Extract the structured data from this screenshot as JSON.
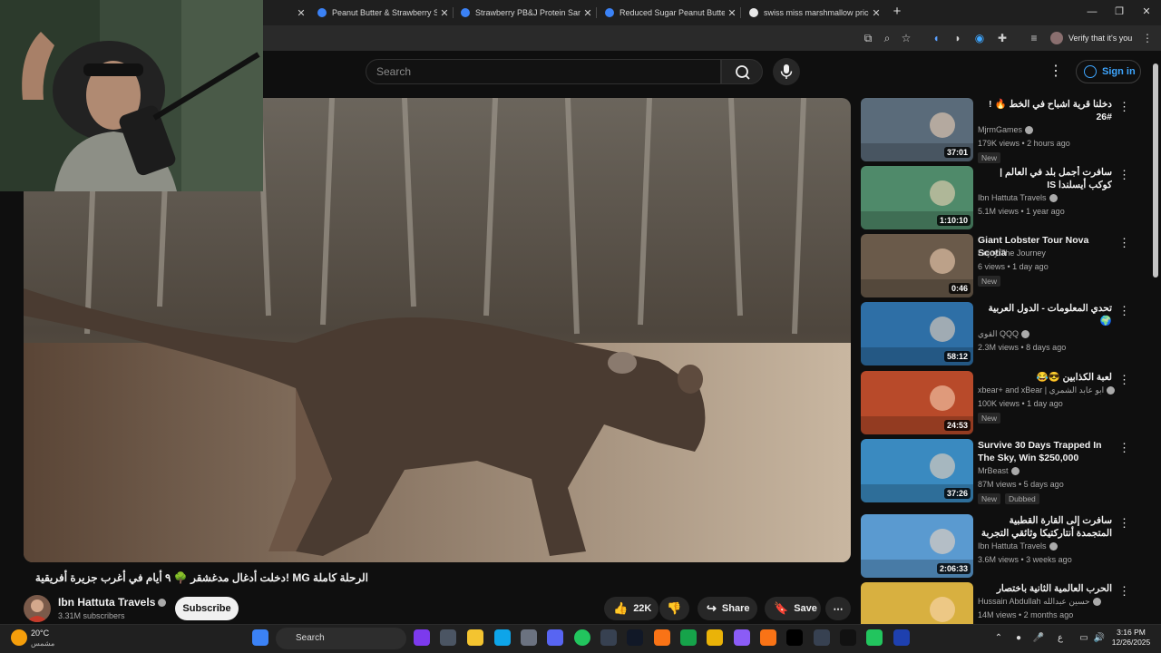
{
  "browser": {
    "tabs": [
      {
        "title": "Peanut Butter & Strawberry Sp"
      },
      {
        "title": "Strawberry PB&J Protein Sandw"
      },
      {
        "title": "Reduced Sugar Peanut Butter &"
      },
      {
        "title": "swiss miss marshmallow price -"
      }
    ],
    "profile_label": "Verify that it's you"
  },
  "header": {
    "search_placeholder": "Search",
    "sign_in": "Sign in"
  },
  "video": {
    "title": "الرحلة كاملة MG !دخلت أدغال مدغشقر 🌳 ٩ أيام في أغرب جزيرة أفريقية",
    "channel": "Ibn Hattuta Travels",
    "subscribers": "3.31M subscribers",
    "subscribe": "Subscribe",
    "likes": "22K",
    "share": "Share",
    "save": "Save"
  },
  "recommendations": [
    {
      "title": "دخلنا قرية اشباح في الخط 🔥 ! #26",
      "rtl": true,
      "channel": "MjrmGames",
      "verified": true,
      "meta": "179K views • 2 hours ago",
      "duration": "37:01",
      "badge": "New"
    },
    {
      "title": "سافرت أجمل بلد في العالم | كوكب أيسلندا IS",
      "rtl": true,
      "channel": "Ibn Hattuta Travels",
      "verified": true,
      "meta": "5.1M views • 1 year ago",
      "duration": "1:10:10"
    },
    {
      "title": "Giant Lobster Tour Nova Scotia",
      "rtl": false,
      "channel": "Enjoy The Journey",
      "verified": false,
      "meta": "6 views • 1 day ago",
      "duration": "0:46",
      "badge": "New"
    },
    {
      "title": "تحدي المعلومات - الدول العربية 🌍",
      "rtl": true,
      "channel": "القوي QQQ",
      "verified": true,
      "meta": "2.3M views • 8 days ago",
      "duration": "58:12"
    },
    {
      "title": "لعبة الكذابين 😎😂",
      "rtl": true,
      "channel": "xbear+ and xBear | ابو عابد الشمري",
      "verified": true,
      "meta": "100K views • 1 day ago",
      "duration": "24:53",
      "badge": "New"
    },
    {
      "title": "Survive 30 Days Trapped In The Sky, Win $250,000",
      "rtl": false,
      "channel": "MrBeast",
      "verified": true,
      "meta": "87M views • 5 days ago",
      "duration": "37:26",
      "badge": "New",
      "dubbed": "Dubbed"
    },
    {
      "title": "سافرت إلى القارة القطبية المتجمدة أنتاركتيكا وثائقي التجربة كاملة AQ",
      "rtl": true,
      "channel": "Ibn Hattuta Travels",
      "verified": true,
      "meta": "3.6M views • 3 weeks ago",
      "duration": "2:06:33"
    },
    {
      "title": "الحرب العالمية الثانية باختصار",
      "rtl": true,
      "channel": "Hussain Abdullah حسين عبدالله",
      "verified": true,
      "meta": "14M views • 2 months ago",
      "duration": ""
    }
  ],
  "taskbar": {
    "temperature": "20°C",
    "weather": "مشمس",
    "search": "Search",
    "time": "3:16 PM",
    "date": "12/26/2025"
  }
}
